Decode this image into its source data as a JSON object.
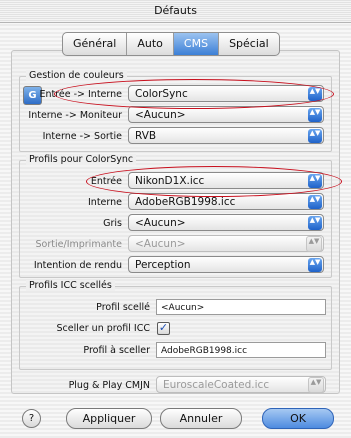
{
  "window": {
    "title": "Défauts"
  },
  "tabs": [
    {
      "label": "Général"
    },
    {
      "label": "Auto"
    },
    {
      "label": "CMS"
    },
    {
      "label": "Spécial"
    }
  ],
  "color_management": {
    "title": "Gestion de couleurs",
    "rows": [
      {
        "label": "Entrée -> Interne",
        "value": "ColorSync"
      },
      {
        "label": "Interne -> Moniteur",
        "value": "<Aucun>"
      },
      {
        "label": "Interne -> Sortie",
        "value": "RVB"
      }
    ]
  },
  "colorsync_profiles": {
    "title": "Profils pour ColorSync",
    "rows": [
      {
        "label": "Entrée",
        "value": "NikonD1X.icc"
      },
      {
        "label": "Interne",
        "value": "AdobeRGB1998.icc"
      },
      {
        "label": "Gris",
        "value": "<Aucun>"
      },
      {
        "label": "Sortie/Imprimante",
        "value": "<Aucun>"
      },
      {
        "label": "Intention de rendu",
        "value": "Perception"
      }
    ]
  },
  "icc_sealed": {
    "title": "Profils ICC scellés",
    "sealed_label": "Profil scellé",
    "sealed_value": "<Aucun>",
    "seal_label": "Sceller un profil ICC",
    "seal_checked": "✓",
    "to_seal_label": "Profil à sceller",
    "to_seal_value": "AdobeRGB1998.icc"
  },
  "plug_play": {
    "label": "Plug & Play CMJN",
    "value": "EuroscaleCoated.icc"
  },
  "buttons": {
    "help": "?",
    "apply": "Appliquer",
    "cancel": "Annuler",
    "ok": "OK"
  },
  "icons": {
    "cms": "G",
    "arrows": "▲▼"
  },
  "colors": {
    "accent": "#3c7fd6",
    "highlight_oval": "#c8101e"
  }
}
